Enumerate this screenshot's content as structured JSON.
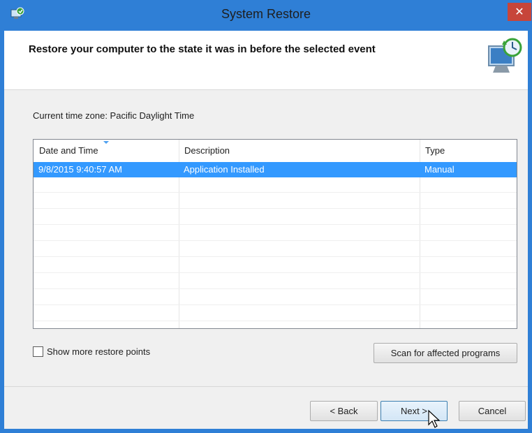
{
  "window": {
    "title": "System Restore",
    "close_symbol": "✕"
  },
  "header": {
    "text": "Restore your computer to the state it was in before the selected event"
  },
  "timezone": {
    "label": "Current time zone: Pacific Daylight Time"
  },
  "table": {
    "columns": [
      "Date and Time",
      "Description",
      "Type"
    ],
    "rows": [
      {
        "date": "9/8/2015 9:40:57 AM",
        "description": "Application Installed",
        "type": "Manual"
      }
    ]
  },
  "options": {
    "show_more_label": "Show more restore points",
    "show_more_checked": false
  },
  "buttons": {
    "scan": "Scan for affected programs",
    "back": "< Back",
    "next": "Next >",
    "cancel": "Cancel"
  },
  "colors": {
    "title_bar": "#2f7fd6",
    "selection": "#3399ff",
    "close": "#c7453a"
  },
  "icons": {
    "title": "system-restore-icon",
    "header": "restore-computer-icon",
    "close": "close-icon",
    "cursor": "mouse-pointer-icon"
  }
}
